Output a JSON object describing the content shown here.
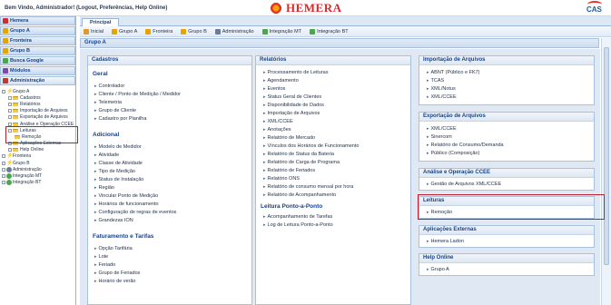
{
  "header": {
    "welcome": "Bem Vindo, Administrador! (Logout, Preferências, Help Online)",
    "logo_text": "HEMERA",
    "corner_logo": "CAS"
  },
  "sidebar": {
    "accordions": [
      {
        "label": "Hemera",
        "icon": "hemera-icon"
      },
      {
        "label": "Grupo A",
        "icon": "bolt-icon"
      },
      {
        "label": "Fronteira",
        "icon": "bolt-icon"
      },
      {
        "label": "Grupo B",
        "icon": "bolt-icon"
      },
      {
        "label": "Busca Google",
        "icon": "globe-icon"
      },
      {
        "label": "Módulos",
        "icon": "module-icon"
      },
      {
        "label": "Administração",
        "icon": "gear-icon"
      }
    ],
    "tree": [
      {
        "label": "Grupo A",
        "level": 0,
        "kind": "bolt"
      },
      {
        "label": "Cadastros",
        "level": 1,
        "kind": "folder"
      },
      {
        "label": "Relatórios",
        "level": 1,
        "kind": "folder"
      },
      {
        "label": "Importação de Arquivos",
        "level": 1,
        "kind": "folder"
      },
      {
        "label": "Exportação de Arquivos",
        "level": 1,
        "kind": "folder"
      },
      {
        "label": "Análise e Operação CCEE",
        "level": 1,
        "kind": "folder"
      },
      {
        "label": "Leituras",
        "level": 1,
        "kind": "folder"
      },
      {
        "label": "Remoção",
        "level": 2,
        "kind": "folder"
      },
      {
        "label": "Aplicações Externas",
        "level": 1,
        "kind": "folder"
      },
      {
        "label": "Help Online",
        "level": 1,
        "kind": "folder"
      },
      {
        "label": "Fronteira",
        "level": 0,
        "kind": "bolt"
      },
      {
        "label": "Grupo B",
        "level": 0,
        "kind": "bolt"
      },
      {
        "label": "Administração",
        "level": 0,
        "kind": "gear"
      },
      {
        "label": "Integração MT",
        "level": 0,
        "kind": "globe"
      },
      {
        "label": "Integração BT",
        "level": 0,
        "kind": "globe"
      }
    ]
  },
  "tabs": {
    "principal": "Principal"
  },
  "toolbar": [
    {
      "label": "Inicial",
      "color": "#e09a2a"
    },
    {
      "label": "Grupo A",
      "color": "#e6a400"
    },
    {
      "label": "Fronteira",
      "color": "#e6a400"
    },
    {
      "label": "Grupo B",
      "color": "#e6a400"
    },
    {
      "label": "Administração",
      "color": "#6a7d98"
    },
    {
      "label": "Integração MT",
      "color": "#4aa84a"
    },
    {
      "label": "Integração BT",
      "color": "#4aa84a"
    }
  ],
  "group_title": "Grupo A",
  "cadastros": {
    "title": "Cadastros",
    "geral": {
      "title": "Geral",
      "items": [
        "Controlador",
        "Cliente / Ponto de Medição / Medidor",
        "Telemetria",
        "Grupo de Cliente",
        "Cadastro por Planilha"
      ]
    },
    "adicional": {
      "title": "Adicional",
      "items": [
        "Modelo de Medidor",
        "Atividade",
        "Classe de Atividade",
        "Tipo de Medição",
        "Status de Instalação",
        "Região",
        "Vincular Ponto de Medição",
        "Horários de funcionamento",
        "Configuração de regras de eventos",
        "Grandezas ION"
      ]
    },
    "faturamento": {
      "title": "Faturamento e Tarifas",
      "items": [
        "Opção Tarifária",
        "Lote",
        "Feriado",
        "Grupo de Feriados",
        "Horário de verão"
      ]
    }
  },
  "relatorios": {
    "title": "Relatórios",
    "items": [
      "Processamento de Leituras",
      "Agendamento",
      "Eventos",
      "Status Geral de Clientes",
      "Disponibilidade de Dados",
      "Importação de Arquivos",
      "XML/CCEE",
      "Anotações",
      "Relatório de Mercado",
      "Vínculos dos Horários de Funcionamento",
      "Relatório de Status da Bateria",
      "Relatório de Carga de Programa",
      "Relatório de Feriados",
      "Relatório ONS",
      "Relatório de consumo mensal por hora",
      "Relatório de Acompanhamento"
    ],
    "leitura_title": "Leitura Ponto-a-Ponto",
    "leitura_items": [
      "Acompanhamento de Tarefas",
      "Log de Leitura Ponto-a-Ponto"
    ]
  },
  "importacao": {
    "title": "Importação de Arquivos",
    "items": [
      "ABNT (Público e FK7)",
      "TCAS",
      "XML/Notus",
      "XML/CCEE"
    ]
  },
  "exportacao": {
    "title": "Exportação de Arquivos",
    "items": [
      "XML/CCEE",
      "Sinercom",
      "Relatório de Consumo/Demanda",
      "Público (Composição)"
    ]
  },
  "analise": {
    "title": "Análise e Operação CCEE",
    "items": [
      "Gestão de Arquivos XML/CCEE"
    ]
  },
  "leituras": {
    "title": "Leituras",
    "items": [
      "Remoção"
    ]
  },
  "aplicacoes": {
    "title": "Aplicações Externas",
    "items": [
      "Hemera Ladon"
    ]
  },
  "help": {
    "title": "Help Online",
    "items": [
      "Grupo A"
    ]
  }
}
